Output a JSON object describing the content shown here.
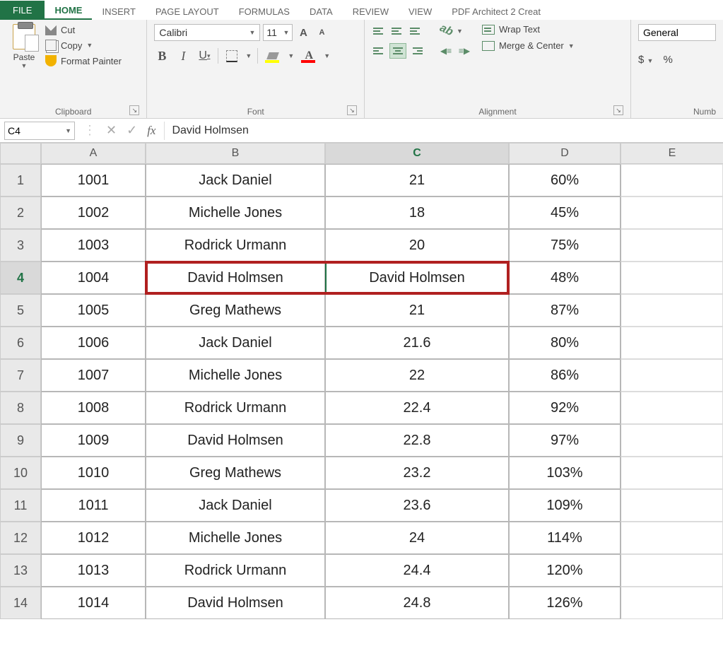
{
  "tabs": {
    "file": "FILE",
    "home": "HOME",
    "insert": "INSERT",
    "page_layout": "PAGE LAYOUT",
    "formulas": "FORMULAS",
    "data": "DATA",
    "review": "REVIEW",
    "view": "VIEW",
    "pdf": "PDF Architect 2 Creat"
  },
  "ribbon": {
    "clipboard": {
      "paste": "Paste",
      "cut": "Cut",
      "copy": "Copy",
      "format_painter": "Format Painter",
      "label": "Clipboard"
    },
    "font": {
      "name": "Calibri",
      "size": "11",
      "bold": "B",
      "italic": "I",
      "underline": "U",
      "grow": "A",
      "shrink": "A",
      "color_letter": "A",
      "label": "Font"
    },
    "alignment": {
      "wrap": "Wrap Text",
      "merge": "Merge & Center",
      "orient": "ab",
      "label": "Alignment"
    },
    "number": {
      "format": "General",
      "currency": "$",
      "percent": "%",
      "label": "Numb"
    }
  },
  "formula_bar": {
    "cell_ref": "C4",
    "fx": "fx",
    "value": "David Holmsen"
  },
  "columns": [
    "A",
    "B",
    "C",
    "D",
    "E"
  ],
  "rows": [
    {
      "n": "1",
      "a": "1001",
      "b": "Jack Daniel",
      "c": "21",
      "d": "60%"
    },
    {
      "n": "2",
      "a": "1002",
      "b": "Michelle Jones",
      "c": "18",
      "d": "45%"
    },
    {
      "n": "3",
      "a": "1003",
      "b": "Rodrick Urmann",
      "c": "20",
      "d": "75%"
    },
    {
      "n": "4",
      "a": "1004",
      "b": "David Holmsen",
      "c": "David Holmsen",
      "d": "48%"
    },
    {
      "n": "5",
      "a": "1005",
      "b": "Greg Mathews",
      "c": "21",
      "d": "87%"
    },
    {
      "n": "6",
      "a": "1006",
      "b": "Jack Daniel",
      "c": "21.6",
      "d": "80%"
    },
    {
      "n": "7",
      "a": "1007",
      "b": "Michelle Jones",
      "c": "22",
      "d": "86%"
    },
    {
      "n": "8",
      "a": "1008",
      "b": "Rodrick Urmann",
      "c": "22.4",
      "d": "92%"
    },
    {
      "n": "9",
      "a": "1009",
      "b": "David Holmsen",
      "c": "22.8",
      "d": "97%"
    },
    {
      "n": "10",
      "a": "1010",
      "b": "Greg Mathews",
      "c": "23.2",
      "d": "103%"
    },
    {
      "n": "11",
      "a": "1011",
      "b": "Jack Daniel",
      "c": "23.6",
      "d": "109%"
    },
    {
      "n": "12",
      "a": "1012",
      "b": "Michelle Jones",
      "c": "24",
      "d": "114%"
    },
    {
      "n": "13",
      "a": "1013",
      "b": "Rodrick Urmann",
      "c": "24.4",
      "d": "120%"
    },
    {
      "n": "14",
      "a": "1014",
      "b": "David Holmsen",
      "c": "24.8",
      "d": "126%"
    }
  ]
}
